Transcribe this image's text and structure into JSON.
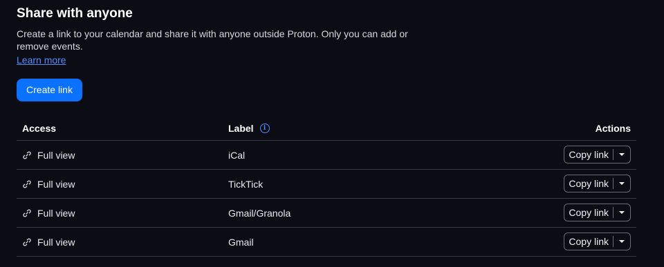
{
  "section": {
    "title": "Share with anyone",
    "description": "Create a link to your calendar and share it with anyone outside Proton. Only you can add or remove events.",
    "learn_more": "Learn more",
    "create_button": "Create link"
  },
  "table": {
    "headers": {
      "access": "Access",
      "label": "Label",
      "actions": "Actions"
    },
    "rows": [
      {
        "access": "Full view",
        "label": "iCal",
        "action": "Copy link"
      },
      {
        "access": "Full view",
        "label": "TickTick",
        "action": "Copy link"
      },
      {
        "access": "Full view",
        "label": "Gmail/Granola",
        "action": "Copy link"
      },
      {
        "access": "Full view",
        "label": "Gmail",
        "action": "Copy link"
      }
    ]
  },
  "icons": {
    "info": "info-icon",
    "link": "link-icon",
    "dropdown": "chevron-down-icon"
  },
  "colors": {
    "background": "#0c0c14",
    "accent": "#0a72ff",
    "link": "#4f8dff"
  }
}
